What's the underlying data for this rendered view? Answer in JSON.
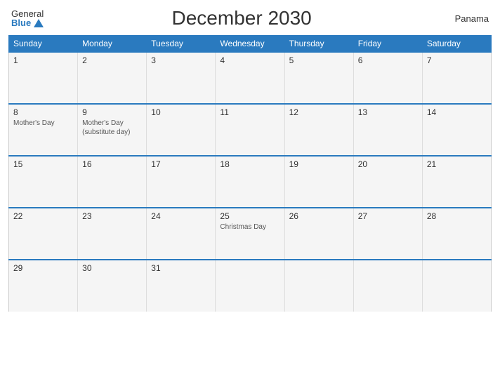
{
  "header": {
    "logo_general": "General",
    "logo_blue": "Blue",
    "title": "December 2030",
    "country": "Panama"
  },
  "weekdays": [
    "Sunday",
    "Monday",
    "Tuesday",
    "Wednesday",
    "Thursday",
    "Friday",
    "Saturday"
  ],
  "weeks": [
    [
      {
        "date": "1",
        "event": ""
      },
      {
        "date": "2",
        "event": ""
      },
      {
        "date": "3",
        "event": ""
      },
      {
        "date": "4",
        "event": ""
      },
      {
        "date": "5",
        "event": ""
      },
      {
        "date": "6",
        "event": ""
      },
      {
        "date": "7",
        "event": ""
      }
    ],
    [
      {
        "date": "8",
        "event": "Mother's Day"
      },
      {
        "date": "9",
        "event": "Mother's Day\n(substitute day)"
      },
      {
        "date": "10",
        "event": ""
      },
      {
        "date": "11",
        "event": ""
      },
      {
        "date": "12",
        "event": ""
      },
      {
        "date": "13",
        "event": ""
      },
      {
        "date": "14",
        "event": ""
      }
    ],
    [
      {
        "date": "15",
        "event": ""
      },
      {
        "date": "16",
        "event": ""
      },
      {
        "date": "17",
        "event": ""
      },
      {
        "date": "18",
        "event": ""
      },
      {
        "date": "19",
        "event": ""
      },
      {
        "date": "20",
        "event": ""
      },
      {
        "date": "21",
        "event": ""
      }
    ],
    [
      {
        "date": "22",
        "event": ""
      },
      {
        "date": "23",
        "event": ""
      },
      {
        "date": "24",
        "event": ""
      },
      {
        "date": "25",
        "event": "Christmas Day"
      },
      {
        "date": "26",
        "event": ""
      },
      {
        "date": "27",
        "event": ""
      },
      {
        "date": "28",
        "event": ""
      }
    ],
    [
      {
        "date": "29",
        "event": ""
      },
      {
        "date": "30",
        "event": ""
      },
      {
        "date": "31",
        "event": ""
      },
      {
        "date": "",
        "event": ""
      },
      {
        "date": "",
        "event": ""
      },
      {
        "date": "",
        "event": ""
      },
      {
        "date": "",
        "event": ""
      }
    ]
  ]
}
